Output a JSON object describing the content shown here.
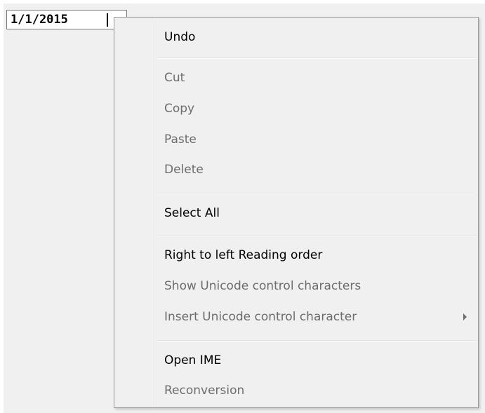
{
  "field": {
    "value": "1/1/2015"
  },
  "context_menu": {
    "items": [
      {
        "label": "Undo",
        "enabled": true
      },
      {
        "label": "Cut",
        "enabled": false
      },
      {
        "label": "Copy",
        "enabled": false
      },
      {
        "label": "Paste",
        "enabled": false
      },
      {
        "label": "Delete",
        "enabled": false
      },
      {
        "label": "Select All",
        "enabled": true
      },
      {
        "label": "Right to left Reading order",
        "enabled": true
      },
      {
        "label": "Show Unicode control characters",
        "enabled": false
      },
      {
        "label": "Insert Unicode control character",
        "enabled": false,
        "submenu_icon": "chevron-right-icon"
      },
      {
        "label": "Open IME",
        "enabled": true
      },
      {
        "label": "Reconversion",
        "enabled": false
      }
    ]
  }
}
